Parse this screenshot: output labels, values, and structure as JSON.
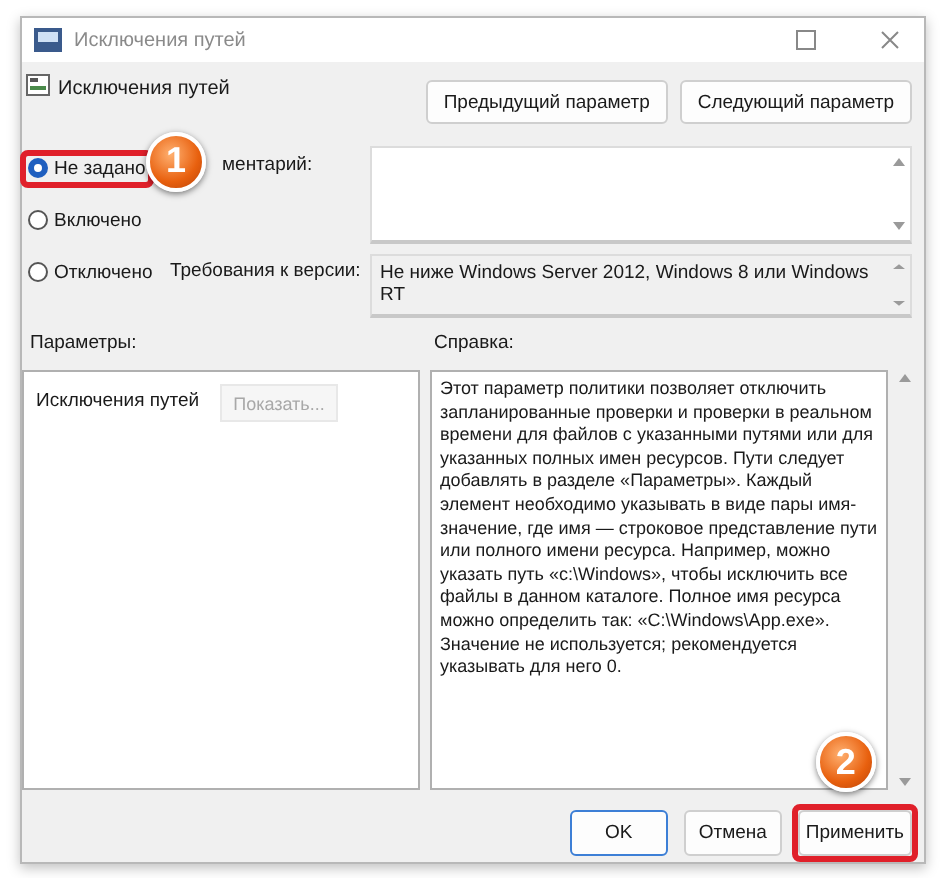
{
  "window": {
    "title": "Исключения путей"
  },
  "header": {
    "title": "Исключения путей",
    "buttons": [
      "Предыдущий параметр",
      "Следующий параметр"
    ]
  },
  "state_options": [
    {
      "label": "Не задано",
      "selected": true,
      "highlighted": true,
      "badge": "1"
    },
    {
      "label": "Включено",
      "selected": false,
      "highlighted": false
    },
    {
      "label": "Отключено",
      "selected": false,
      "highlighted": false
    }
  ],
  "comment": {
    "label": "ментарий:"
  },
  "requirements": {
    "label": "Требования к версии:",
    "value": "Не ниже Windows Server 2012, Windows 8 или Windows RT"
  },
  "options_panel": {
    "label": "Параметры:",
    "setting_label": "Исключения путей",
    "show_button": {
      "label": "Показать...",
      "disabled": true
    }
  },
  "help_panel": {
    "label": "Справка:",
    "text": "Этот параметр политики позволяет отключить запланированные проверки и проверки в реальном времени для файлов с указанными путями или для указанных полных имен ресурсов. Пути следует добавлять в разделе «Параметры». Каждый элемент необходимо указывать в виде пары имя-значение, где имя — строковое представление пути или полного имени ресурса. Например, можно указать путь «c:\\Windows», чтобы исключить все файлы в данном каталоге. Полное имя ресурса можно определить так: «C:\\Windows\\App.exe». Значение не используется; рекомендуется указывать для него 0."
  },
  "footer_buttons": [
    {
      "label": "OK",
      "default": true,
      "highlighted": false
    },
    {
      "label": "Отмена",
      "default": false,
      "highlighted": false
    },
    {
      "label": "Применить",
      "default": false,
      "highlighted": true,
      "badge": "2"
    }
  ]
}
